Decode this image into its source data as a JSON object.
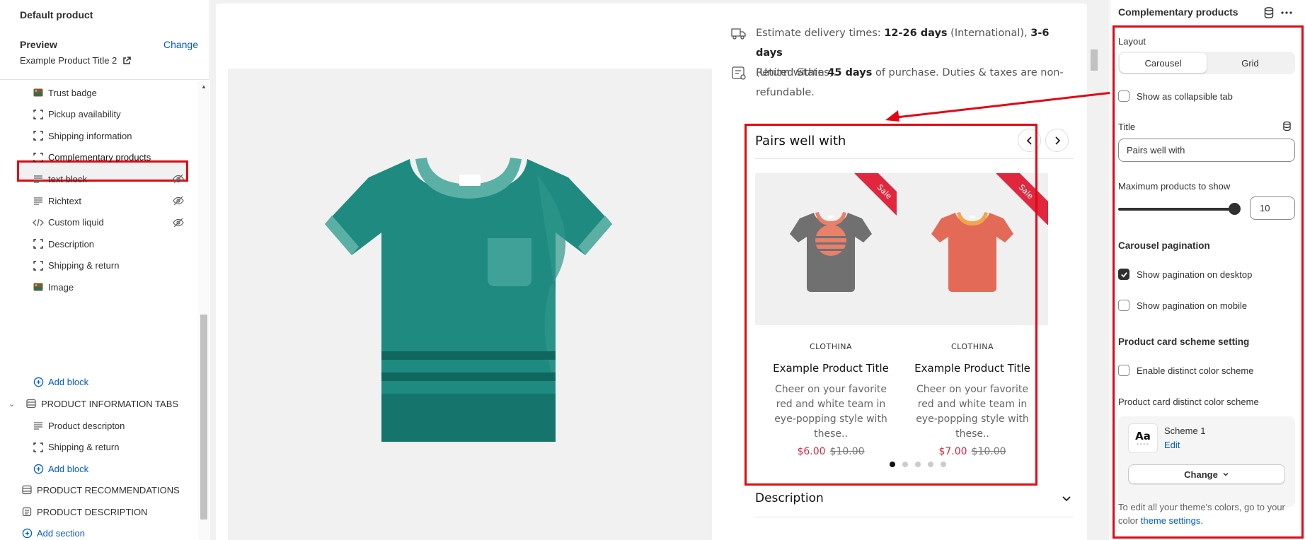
{
  "left": {
    "template_title": "Default product",
    "preview_label": "Preview",
    "change_label": "Change",
    "preview_product": "Example Product Title 2",
    "blocks": [
      {
        "label": "Trust badge",
        "icon": "image-icon",
        "hidden": false
      },
      {
        "label": "Pickup availability",
        "icon": "dashed-square-icon",
        "hidden": false
      },
      {
        "label": "Shipping information",
        "icon": "dashed-square-icon",
        "hidden": false
      },
      {
        "label": "Complementary products",
        "icon": "dashed-square-icon",
        "hidden": false,
        "selected": true
      },
      {
        "label": "text block",
        "icon": "text-lines-icon",
        "hidden": true
      },
      {
        "label": "Richtext",
        "icon": "text-lines-icon",
        "hidden": true
      },
      {
        "label": "Custom liquid",
        "icon": "code-icon",
        "hidden": true
      },
      {
        "label": "Description",
        "icon": "dashed-square-icon",
        "hidden": false
      },
      {
        "label": "Shipping & return",
        "icon": "dashed-square-icon",
        "hidden": false
      },
      {
        "label": "Image",
        "icon": "image-icon",
        "hidden": false
      }
    ],
    "add_block": "Add block",
    "section_tabs": "PRODUCT INFORMATION TABS",
    "tabs_blocks": [
      {
        "label": "Product descripton",
        "icon": "text-lines-icon"
      },
      {
        "label": "Shipping & return",
        "icon": "dashed-square-icon"
      }
    ],
    "add_block_2": "Add block",
    "section_recs": "PRODUCT RECOMMENDATIONS",
    "section_desc": "PRODUCT DESCRIPTION",
    "add_section": "Add section"
  },
  "preview": {
    "delivery": {
      "prefix": "Estimate delivery times: ",
      "intl_days": "12-26 days",
      "intl_label": " (International), ",
      "us_days": "3-6 days",
      "us_label": "(United States)."
    },
    "returns": {
      "prefix": "Return within ",
      "days": "45 days",
      "suffix": " of purchase. Duties & taxes are non-refundable."
    },
    "complementary_title": "Pairs well with",
    "products": [
      {
        "badge": "Sale",
        "vendor": "CLOTHINA",
        "title": "Example Product Title",
        "description": "Cheer on your favorite red and white team in eye-popping style with these..",
        "price": "$6.00",
        "compare_price": "$10.00",
        "shirt_color": "#707070",
        "accent": "#e8806a"
      },
      {
        "badge": "Sale",
        "vendor": "CLOTHINA",
        "title": "Example Product Title",
        "description": "Cheer on your favorite red and white team in eye-popping style with these..",
        "price": "$7.00",
        "compare_price": "$10.00",
        "shirt_color": "#e46a58",
        "accent": "#f0a64a"
      }
    ],
    "pagination_count": 5,
    "pagination_active": 0,
    "description_heading": "Description"
  },
  "settings": {
    "panel_title": "Complementary products",
    "layout_label": "Layout",
    "layout_options": [
      "Carousel",
      "Grid"
    ],
    "layout_selected": "Carousel",
    "collapsible_label": "Show as collapsible tab",
    "collapsible_checked": false,
    "title_label": "Title",
    "title_value": "Pairs well with",
    "max_products_label": "Maximum products to show",
    "max_products_value": "10",
    "pagination_heading": "Carousel pagination",
    "pagination_desktop_label": "Show pagination on desktop",
    "pagination_desktop_checked": true,
    "pagination_mobile_label": "Show pagination on mobile",
    "pagination_mobile_checked": false,
    "scheme_heading": "Product card scheme setting",
    "distinct_label": "Enable distinct color scheme",
    "distinct_checked": false,
    "distinct_scheme_label": "Product card distinct color scheme",
    "scheme_swatch_text": "Aa",
    "scheme_name": "Scheme 1",
    "scheme_edit": "Edit",
    "scheme_change": "Change",
    "footnote_prefix": "To edit all your theme's colors, go to your color ",
    "footnote_link": "theme settings."
  },
  "colors": {
    "highlight": "#e30613",
    "link": "#005bd3",
    "sale": "#e0273e",
    "tshirt": "#1f8a80"
  }
}
